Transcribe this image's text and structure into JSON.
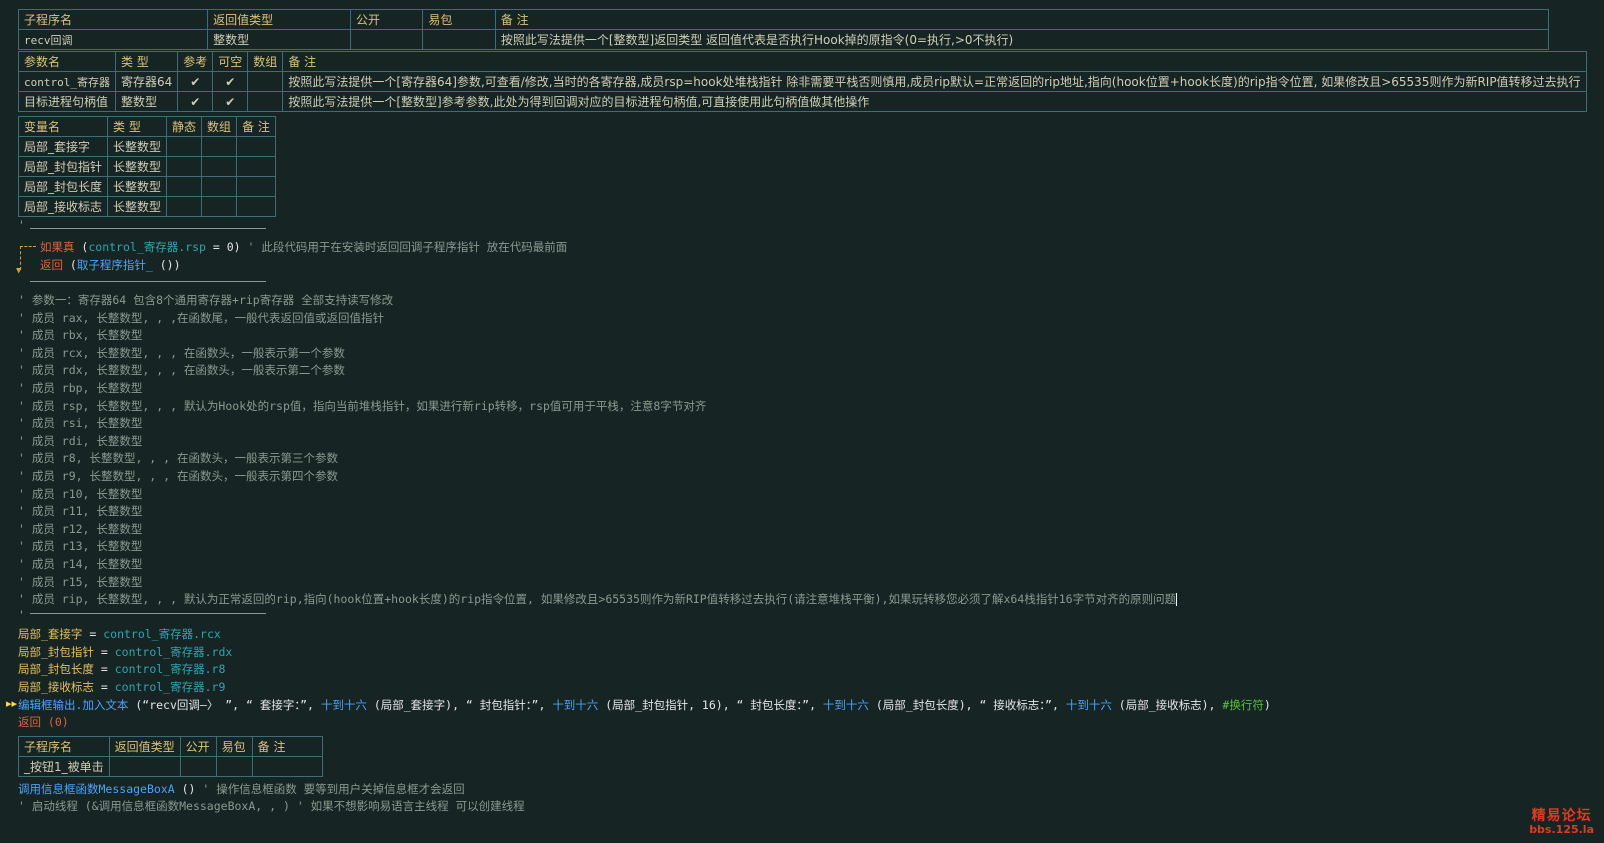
{
  "sub_table_1": {
    "header": [
      "子程序名",
      "返回值类型",
      "公开",
      "易包",
      "备 注"
    ],
    "row": [
      "recv回调",
      "整数型",
      "",
      "",
      "按照此写法提供一个[整数型]返回类型 返回值代表是否执行Hook掉的原指令(0=执行,>0不执行)"
    ],
    "param_header": [
      "参数名",
      "类 型",
      "参考",
      "可空",
      "数组",
      "备 注"
    ],
    "params": [
      [
        "control_寄存器",
        "寄存器64",
        "✔",
        "✔",
        "",
        "按照此写法提供一个[寄存器64]参数,可查看/修改,当时的各寄存器,成员rsp=hook处堆栈指针 除非需要平栈否则慎用,成员rip默认=正常返回的rip地址,指向(hook位置+hook长度)的rip指令位置, 如果修改且>65535则作为新RIP值转移过去执行"
      ],
      [
        "目标进程句柄值",
        "整数型",
        "✔",
        "✔",
        "",
        "按照此写法提供一个[整数型]参考参数,此处为得到回调对应的目标进程句柄值,可直接使用此句柄值做其他操作"
      ]
    ]
  },
  "var_table": {
    "header": [
      "变量名",
      "类 型",
      "静态",
      "数组",
      "备 注"
    ],
    "rows": [
      [
        "局部_套接字",
        "长整数型",
        "",
        "",
        ""
      ],
      [
        "局部_封包指针",
        "长整数型",
        "",
        "",
        ""
      ],
      [
        "局部_封包长度",
        "长整数型",
        "",
        "",
        ""
      ],
      [
        "局部_接收标志",
        "长整数型",
        "",
        "",
        ""
      ]
    ]
  },
  "code": {
    "if_kw": "如果真",
    "if_cond_open": " (",
    "if_cond_var": "control_寄存器.rsp",
    "if_cond_rest": " = 0)",
    "if_comment": " ' 此段代码用于在安装时返回回调子程序指针 放在代码最前面",
    "ret_kw": "返回",
    "ret_open": " (",
    "ret_call": "取子程序指针_",
    "ret_close": " ())",
    "comments": [
      "' 参数一：寄存器64 包含8个通用寄存器+rip寄存器  全部支持读写修改",
      "' 成员 rax, 长整数型, , ,在函数尾，一般代表返回值或返回值指针",
      "' 成员 rbx, 长整数型",
      "' 成员 rcx, 长整数型, , , 在函数头，一般表示第一个参数",
      "' 成员 rdx, 长整数型, , , 在函数头，一般表示第二个参数",
      "' 成员 rbp, 长整数型",
      "' 成员 rsp, 长整数型, , , 默认为Hook处的rsp值，指向当前堆栈指针，如果进行新rip转移，rsp值可用于平栈，注意8字节对齐",
      "' 成员 rsi, 长整数型",
      "' 成员 rdi, 长整数型",
      "' 成员 r8, 长整数型, , , 在函数头，一般表示第三个参数",
      "' 成员 r9, 长整数型, , , 在函数头，一般表示第四个参数",
      "' 成员 r10, 长整数型",
      "' 成员 r11, 长整数型",
      "' 成员 r12, 长整数型",
      "' 成员 r13, 长整数型",
      "' 成员 r14, 长整数型",
      "' 成员 r15, 长整数型",
      "' 成员 rip, 长整数型, , , 默认为正常返回的rip,指向(hook位置+hook长度)的rip指令位置, 如果修改且>65535则作为新RIP值转移过去执行(请注意堆栈平衡),如果玩转移您必须了解x64栈指针16字节对齐的原则问题"
    ],
    "assigns": [
      {
        "lhs": "局部_套接字",
        "rhs": "control_寄存器.rcx"
      },
      {
        "lhs": "局部_封包指针",
        "rhs": "control_寄存器.rdx"
      },
      {
        "lhs": "局部_封包长度",
        "rhs": "control_寄存器.r8"
      },
      {
        "lhs": "局部_接收标志",
        "rhs": "control_寄存器.r9"
      }
    ],
    "eq": " = ",
    "debug_line": {
      "a": "编辑框输出.加入文本",
      "b": " (“recv回调—〉 ”, “ 套接字：”, ",
      "c": "十到十六",
      "d": " (局部_套接字), “ 封包指针：”, ",
      "e": "十到十六",
      "f": " (局部_封包指针, 16), “ 封包长度：”, ",
      "g": "十到十六",
      "h": " (局部_封包长度), “ 接收标志：”, ",
      "i": "十到十六",
      "j": " (局部_接收标志), ",
      "k": "#换行符",
      "l": ")"
    },
    "return0_kw": "返回",
    "return0_rest": " (0)"
  },
  "sub_table_2": {
    "header": [
      "子程序名",
      "返回值类型",
      "公开",
      "易包",
      "备 注"
    ],
    "row": [
      "_按钮1_被单击",
      "",
      "",
      "",
      ""
    ]
  },
  "code2": {
    "call_a": "调用信息框函数MessageBoxA",
    "call_b": " ()",
    "call_comment": " ' 操作信息框函数 要等到用户关掉信息框才会返回",
    "thread_line": "' 启动线程 (&调用信息框函数MessageBoxA, , ) ' 如果不想影响易语言主线程 可以创建线程"
  },
  "watermark": {
    "line1": "精易论坛",
    "line2": "bbs.125.la"
  }
}
